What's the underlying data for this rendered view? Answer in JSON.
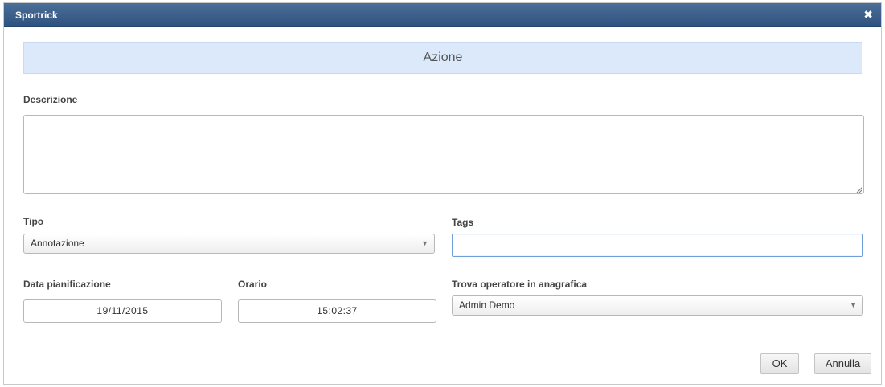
{
  "window": {
    "title": "Sportrick",
    "close_glyph": "✖",
    "close_icon": "close-icon"
  },
  "section": {
    "header": "Azione"
  },
  "form": {
    "descrizione": {
      "label": "Descrizione",
      "value": ""
    },
    "tipo": {
      "label": "Tipo",
      "selected": "Annotazione"
    },
    "tags": {
      "label": "Tags",
      "value": ""
    },
    "data_pianificazione": {
      "label": "Data pianificazione",
      "value": "19/11/2015"
    },
    "orario": {
      "label": "Orario",
      "value": "15:02:37"
    },
    "operatore": {
      "label": "Trova operatore in anagrafica",
      "selected": "Admin Demo"
    }
  },
  "footer": {
    "ok_label": "OK",
    "cancel_label": "Annulla"
  },
  "colors": {
    "titlebar": "#2e527f",
    "header_band": "#dbe9fa",
    "focus_border": "#6f9fd8"
  }
}
